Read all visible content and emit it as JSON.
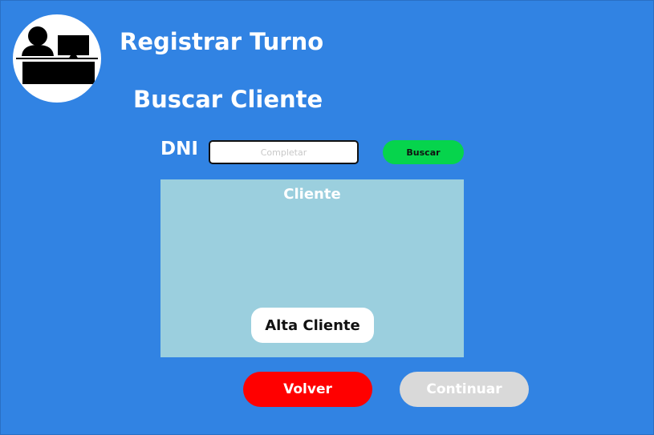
{
  "header": {
    "title": "Registrar Turno",
    "logo_icon": "receptionist-desk-icon"
  },
  "section": {
    "title": "Buscar Cliente"
  },
  "search": {
    "label": "DNI",
    "value": "",
    "placeholder": "Completar",
    "button_label": "Buscar"
  },
  "client_panel": {
    "heading": "Cliente",
    "add_button_label": "Alta Cliente"
  },
  "footer": {
    "back_label": "Volver",
    "continue_label": "Continuar",
    "continue_enabled": false
  },
  "colors": {
    "background": "#3183e3",
    "panel": "#9bcfde",
    "search_button": "#06d44c",
    "back_button": "#ff0000",
    "continue_button_disabled": "#d9d9d9"
  }
}
